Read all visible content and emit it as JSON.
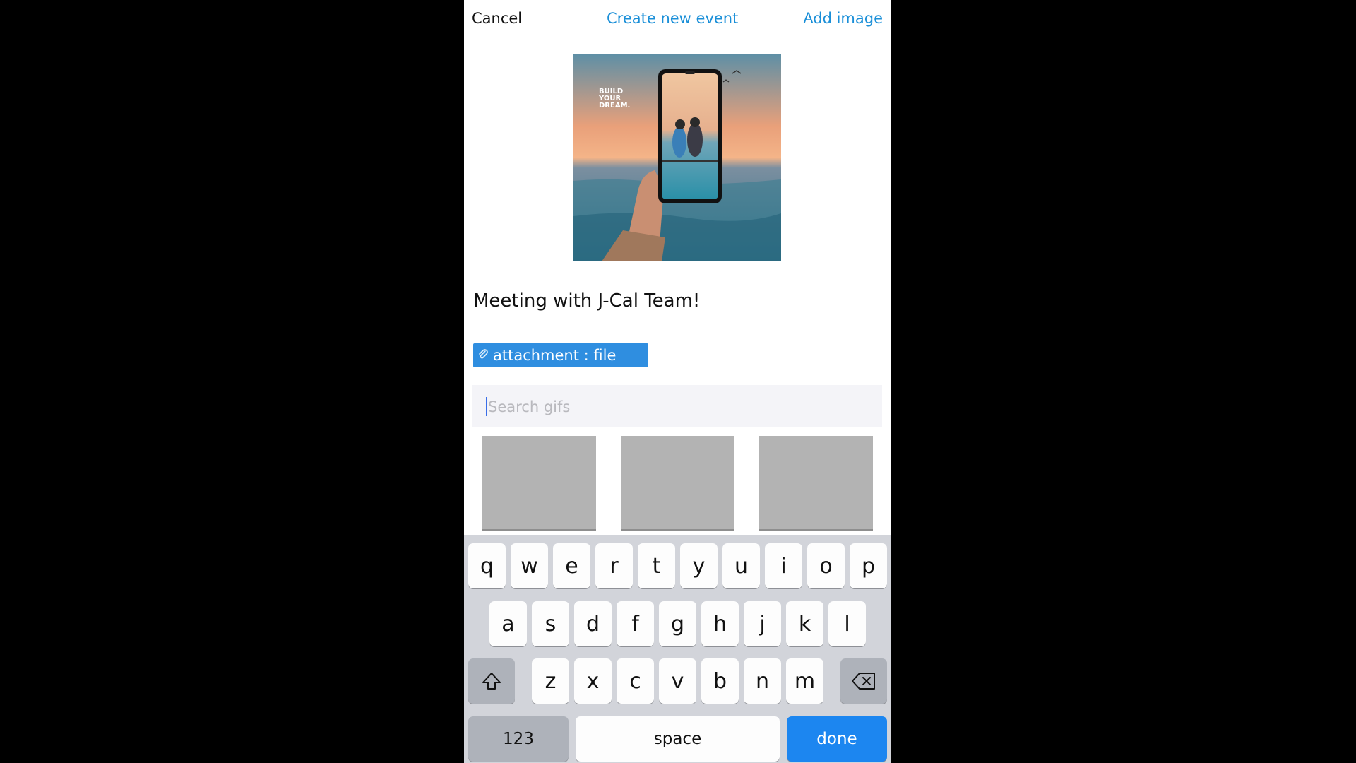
{
  "nav": {
    "cancel_label": "Cancel",
    "title": "Create new event",
    "add_image_label": "Add image"
  },
  "photo": {
    "overlay_text": "BUILD YOUR DREAM."
  },
  "event": {
    "title": "Meeting with J-Cal Team!"
  },
  "attachment": {
    "label": "attachment : file",
    "icon": "paperclip-icon"
  },
  "search": {
    "placeholder": "Search gifs",
    "value": ""
  },
  "gif_results": [
    {
      "label": "gif-1"
    },
    {
      "label": "gif-2"
    },
    {
      "label": "gif-3"
    }
  ],
  "keyboard": {
    "row1": [
      "q",
      "w",
      "e",
      "r",
      "t",
      "y",
      "u",
      "i",
      "o",
      "p"
    ],
    "row2": [
      "a",
      "s",
      "d",
      "f",
      "g",
      "h",
      "j",
      "k",
      "l"
    ],
    "row3": [
      "z",
      "x",
      "c",
      "v",
      "b",
      "n",
      "m"
    ],
    "numbers_label": "123",
    "space_label": "space",
    "done_label": "done",
    "shift_icon": "shift-icon",
    "backspace_icon": "backspace-icon"
  },
  "colors": {
    "accent": "#1a8fd8",
    "attachment_bg": "#2f8ee0",
    "done_key": "#1c86f0",
    "keyboard_bg": "#d2d4da",
    "gif_placeholder": "#b3b3b3"
  }
}
